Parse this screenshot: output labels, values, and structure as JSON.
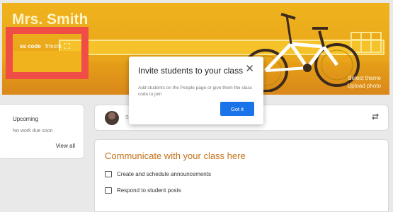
{
  "banner": {
    "title": "Mrs. Smith",
    "class_code_label": "ss code",
    "class_code_value": "frmcrb",
    "fullscreen_icon": "fullscreen-icon",
    "select_theme": "Select theme",
    "upload_photo": "Upload photo"
  },
  "upcoming": {
    "title": "Upcoming",
    "subtitle": "No work due soon",
    "link": "View all"
  },
  "share": {
    "text": "Sh",
    "repost_icon": "repost-icon"
  },
  "communicate": {
    "title": "Communicate with your class here",
    "items": [
      {
        "label": "Create and schedule announcements",
        "icon": "announcement-icon"
      },
      {
        "label": "Respond to student posts",
        "icon": "posts-icon"
      }
    ]
  },
  "dialog": {
    "title": "Invite students to your class",
    "body": "Add students on the People page or give them the class code to join",
    "button": "Got it",
    "close_icon": "close-icon"
  },
  "colors": {
    "banner": "#e9a61a",
    "highlight": "#ef4d45",
    "accent_text": "#c2711a",
    "primary_button": "#1a73e8"
  }
}
